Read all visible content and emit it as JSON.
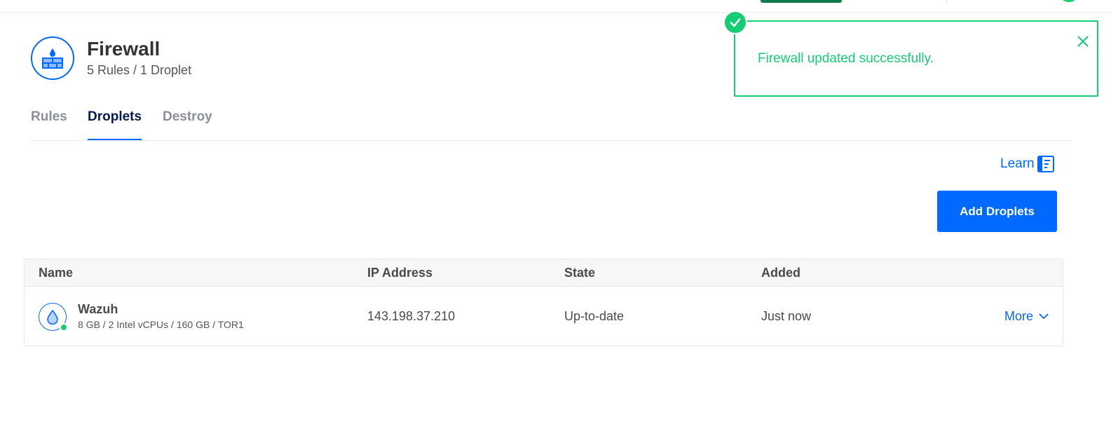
{
  "header": {
    "title": "Firewall",
    "subtitle": "5 Rules / 1 Droplet",
    "icon": "firewall-icon"
  },
  "tabs": [
    {
      "label": "Rules",
      "active": false
    },
    {
      "label": "Droplets",
      "active": true
    },
    {
      "label": "Destroy",
      "active": false
    }
  ],
  "actions": {
    "learn_label": "Learn",
    "learn_icon": "document-icon",
    "add_droplets_label": "Add Droplets"
  },
  "table": {
    "columns": [
      "Name",
      "IP Address",
      "State",
      "Added"
    ],
    "rows": [
      {
        "name": "Wazuh",
        "meta": "8 GB / 2 Intel vCPUs / 160 GB / TOR1",
        "ip": "143.198.37.210",
        "state": "Up-to-date",
        "added": "Just now",
        "more_label": "More",
        "status": "online"
      }
    ]
  },
  "toast": {
    "message": "Firewall updated successfully.",
    "type": "success"
  },
  "colors": {
    "accent": "#0069ff",
    "success": "#15cd72",
    "title": "#333333"
  }
}
